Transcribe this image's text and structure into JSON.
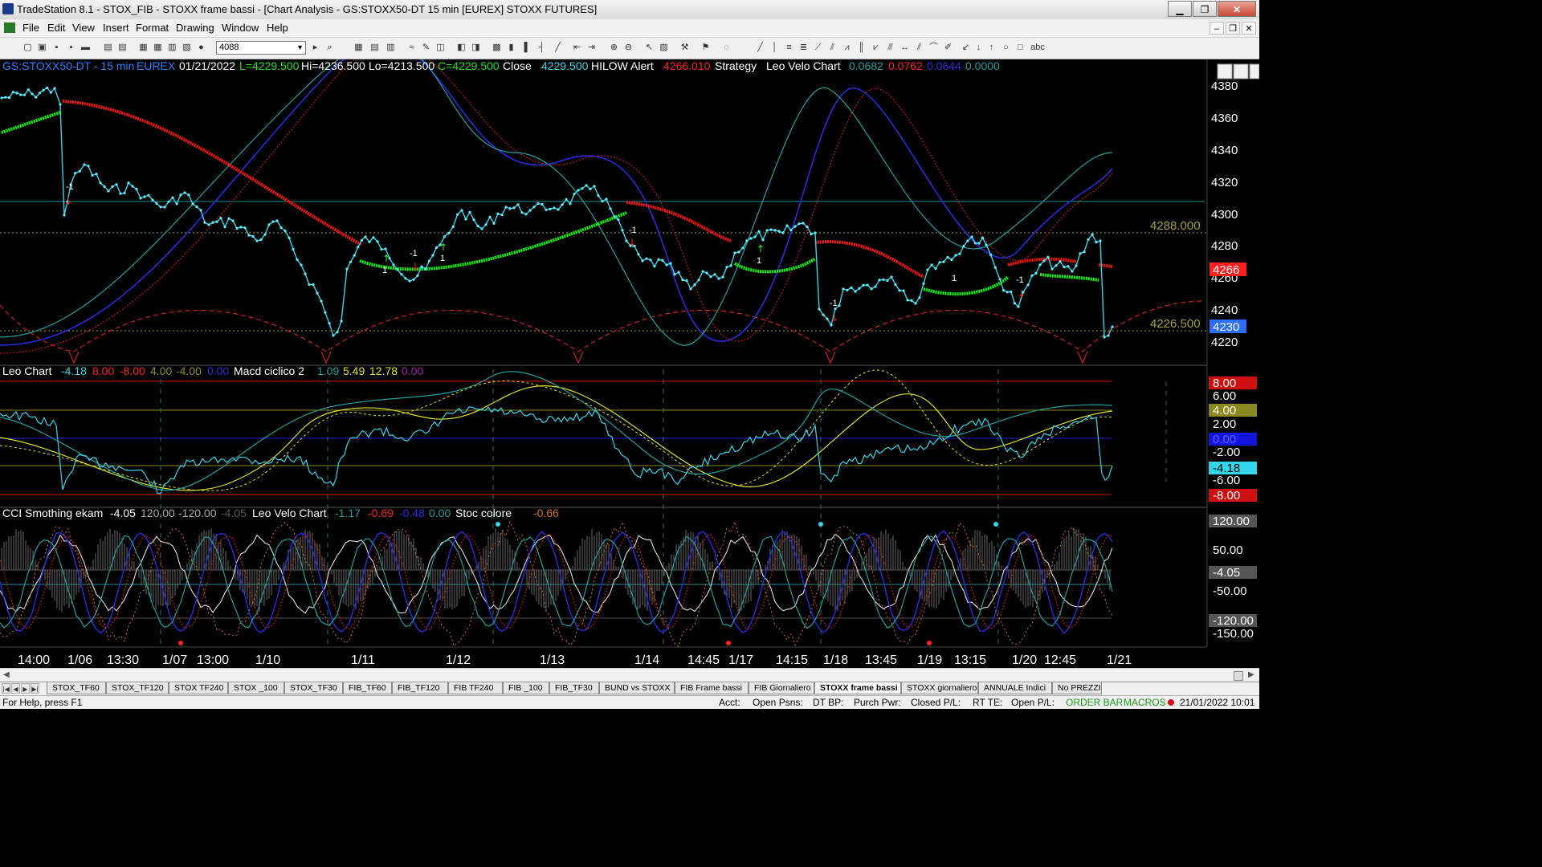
{
  "window": {
    "title": "TradeStation 8.1 - STOX_FIB - STOXX frame bassi - [Chart Analysis - GS:STOXX50-DT  15 min  [EUREX] STOXX FUTURES]",
    "minimize": "▁",
    "restore": "❐",
    "close": "✕"
  },
  "menu": [
    "File",
    "Edit",
    "View",
    "Insert",
    "Format",
    "Drawing",
    "Window",
    "Help"
  ],
  "mdi_buttons": [
    "–",
    "❐",
    "✕"
  ],
  "toolbar": {
    "symbol_combo": "4088"
  },
  "chart": {
    "header_symbol": "GS:STOXX50-DT - 15 min",
    "header_exchange": "EUREX",
    "header_date": "01/21/2022",
    "header_L": "L=4229.500",
    "header_Hi": "Hi=4236.500",
    "header_Lo": "Lo=4213.500",
    "header_C": "C=4229.500",
    "header_close_label": "Close",
    "header_close_value": "4229.500",
    "header_hilow": "HILOW Alert",
    "header_hilow_value": "4266.010",
    "header_strategy": "Strategy",
    "header_leovelo": "Leo Velo Chart",
    "header_v1": "0.0682",
    "header_v2": "0.0762",
    "header_v3": "0.0644",
    "header_v4": "0.0000",
    "sub1_name": "Leo Chart",
    "sub1_v1": "-4.18",
    "sub1_v2": "8.00",
    "sub1_v3": "-8.00",
    "sub1_v4": "4.00",
    "sub1_v5": "-4.00",
    "sub1_v6": "0.00",
    "sub1_name2": "Macd ciclico 2",
    "sub1_v7": "1.09",
    "sub1_v8": "5.49",
    "sub1_v9": "12.78",
    "sub1_v10": "0.00",
    "sub2_name": "CCI Smothing ekam",
    "sub2_v1": "-4.05",
    "sub2_v2": "120.00",
    "sub2_v3": "-120.00",
    "sub2_v4": "-4.05",
    "sub2_name2": "Leo Velo Chart",
    "sub2_v5": "-1.17",
    "sub2_v6": "-0.69",
    "sub2_v7": "-0.48",
    "sub2_v8": "0.00",
    "sub2_name3": "Stoc colore",
    "sub2_v9": "-0.66",
    "price_ticks": [
      "4380",
      "4360",
      "4340",
      "4320",
      "4300",
      "4280",
      "4260",
      "4240",
      "4220"
    ],
    "price_label_4288": "4288.000",
    "price_label_4226": "4226.500",
    "price_tag_4266": "4266",
    "price_tag_4230": "4230",
    "sub1_ticks": [
      "8.00",
      "6.00",
      "4.00",
      "2.00",
      "0.00",
      "-2.00",
      "-4.18",
      "-6.00",
      "-8.00"
    ],
    "sub2_ticks": [
      "120.00",
      "50.00",
      "-4.05",
      "-50.00",
      "-120.00",
      "-150.00"
    ],
    "x_labels": [
      "14:00",
      "1/06",
      "13:30",
      "1/07",
      "13:00",
      "1/10",
      "1/11",
      "1/12",
      "1/13",
      "1/14",
      "14:45",
      "1/17",
      "14:15",
      "1/18",
      "13:45",
      "1/19",
      "13:15",
      "1/20",
      "12:45",
      "1/21"
    ],
    "marker_pos": "1",
    "marker_neg": "-1",
    "colors": {
      "price": "#33d6ea",
      "hilow_up": "#00ff00",
      "hilow_down": "#ff0000",
      "cycle": "#ff2020"
    }
  },
  "tabs": [
    "STOX_TF60",
    "STOX_TF120",
    "STOX TF240",
    "STOX _100",
    "STOX_TF30",
    "FIB_TF60",
    "FIB_TF120",
    "FIB TF240",
    "FIB _100",
    "FIB_TF30",
    "BUND vs STOXX",
    "FIB Frame bassi",
    "FIB Giornaliero",
    "STOXX frame bassi",
    "STOXX giornaliero",
    "ANNUALE Indici",
    "No PREZZI"
  ],
  "active_tab": "STOXX frame bassi",
  "status": {
    "help": "For Help, press F1",
    "acct": "Acct:",
    "open_psns": "Open Psns:",
    "dt_bp": "DT BP:",
    "purch_pwr": "Purch Pwr:",
    "closed_pl": "Closed P/L:",
    "rt_te": "RT TE:",
    "open_pl": "Open P/L:",
    "order_bar": "ORDER BAR",
    "macros": "MACROS",
    "datetime": "21/01/2022 10:01"
  }
}
